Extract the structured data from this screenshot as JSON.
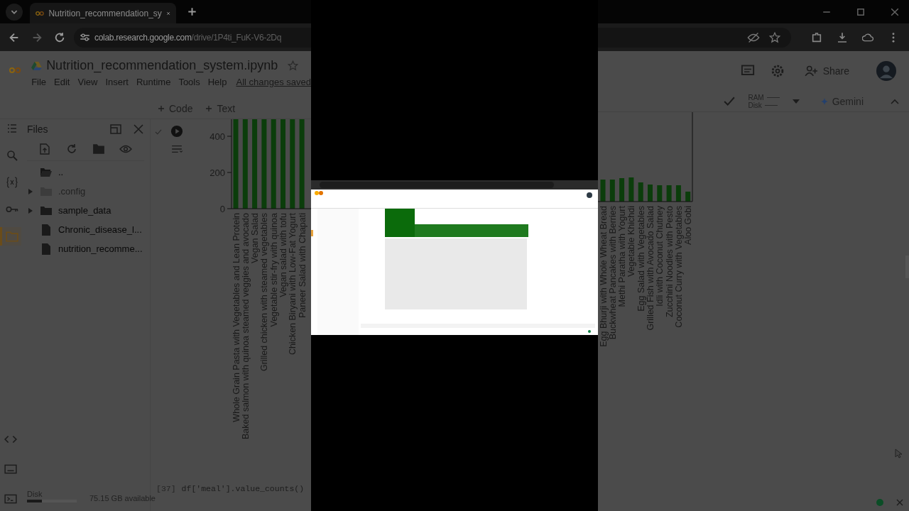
{
  "left_view": {
    "tab_title": "Nutrition_recommendation_sy",
    "url_host": "colab.research.google.com",
    "url_path": "/drive/1P4ti_FuK-V6-2Dq",
    "title": "Nutrition_recommendation_system.ipynb",
    "menu": [
      "File",
      "Edit",
      "View",
      "Insert",
      "Runtime",
      "Tools",
      "Help"
    ],
    "save_status": "All changes saved",
    "add_buttons": [
      "Code",
      "Text"
    ],
    "rail": [
      {
        "kind": "toc",
        "selected": false
      },
      {
        "kind": "search",
        "selected": false
      },
      {
        "kind": "variables",
        "selected": false
      },
      {
        "kind": "secrets",
        "selected": false
      },
      {
        "kind": "files",
        "selected": true
      }
    ],
    "files": {
      "title": "Files",
      "items": [
        {
          "name": "..",
          "kind": "parent",
          "hidden": false
        },
        {
          "name": ".config",
          "kind": "folder",
          "expanded": false,
          "hidden": true
        },
        {
          "name": "sample_data",
          "kind": "folder",
          "expanded": false,
          "hidden": false
        },
        {
          "name": "Chronic_disease_l...",
          "kind": "file",
          "hidden": false
        },
        {
          "name": "nutrition_recomme...",
          "kind": "file",
          "hidden": false
        }
      ],
      "disk_label": "Disk",
      "disk": {
        "level": 0.3
      },
      "disk_free": "75.15 GB available"
    },
    "chart": {
      "ticks": [
        "400",
        "200",
        "0"
      ],
      "labels": [
        "Whole Grain Pasta with Vegetables and Lean Protein",
        "Baked salmon with quinoa steamed veggies and avocado",
        "Vegan Salad",
        "Grilled chicken with steamed vegetables",
        "Vegetable stir-fry with quinoa",
        "Vegan salad with tofu",
        "Chicken Biryani with Low-Fat Yogurt",
        "Paneer Salad with Chapati"
      ]
    },
    "next_cell": {
      "prompt": "[37]",
      "code": "df['meal'].value_counts()"
    }
  },
  "right_view": {
    "share": "Share",
    "resources": [
      "RAM",
      "Disk"
    ],
    "gemini": "Gemini",
    "chart": {
      "labels": [
        "Egg Bhurji with Whole Wheat Bread",
        "Buckwheat Pancakes with Berries",
        "Methi Paratha with Yogurt",
        "Vegetable Khichdi",
        "Egg Salad with Vegetables",
        "Grilled Fish with Avocado Salad",
        "Idli with Coconut Chutney",
        "Zucchini Noodles with Pesto",
        "Coconut Curry with Vegetables",
        "Aloo Gobi"
      ]
    }
  }
}
